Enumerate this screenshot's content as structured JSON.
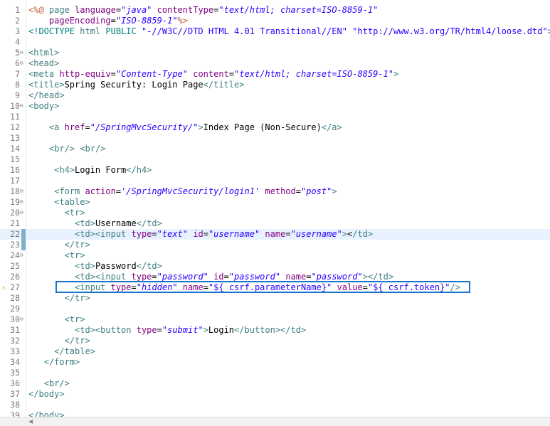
{
  "editor": {
    "current_line": 22,
    "lines": [
      {
        "n": "1",
        "fold": "",
        "tokens": [
          [
            "jsp",
            "<%@ "
          ],
          [
            "tag",
            "page "
          ],
          [
            "attr",
            "language"
          ],
          [
            "txt",
            "="
          ],
          [
            "val",
            "\"java\""
          ],
          [
            "txt",
            " "
          ],
          [
            "attr",
            "contentType"
          ],
          [
            "txt",
            "="
          ],
          [
            "val",
            "\"text/html; charset=ISO-8859-1\""
          ]
        ]
      },
      {
        "n": "2",
        "fold": "",
        "tokens": [
          [
            "txt",
            "    "
          ],
          [
            "attr",
            "pageEncoding"
          ],
          [
            "txt",
            "="
          ],
          [
            "val",
            "\"ISO-8859-1\""
          ],
          [
            "jsp",
            "%>"
          ]
        ]
      },
      {
        "n": "3",
        "fold": "",
        "tokens": [
          [
            "doc",
            "<!DOCTYPE "
          ],
          [
            "tag",
            "html "
          ],
          [
            "doc",
            "PUBLIC "
          ],
          [
            "valn",
            "\"-//W3C//DTD HTML 4.01 Transitional//EN\""
          ],
          [
            "txt",
            " "
          ],
          [
            "valn",
            "\"http://www.w3.org/TR/html4/loose.dtd\""
          ],
          [
            "doc",
            ">"
          ]
        ]
      },
      {
        "n": "4",
        "fold": "",
        "tokens": []
      },
      {
        "n": "5",
        "fold": "⊖",
        "tokens": [
          [
            "tag",
            "<html>"
          ]
        ]
      },
      {
        "n": "6",
        "fold": "⊖",
        "tokens": [
          [
            "tag",
            "<head>"
          ]
        ]
      },
      {
        "n": "7",
        "fold": "",
        "tokens": [
          [
            "tag",
            "<meta "
          ],
          [
            "attr",
            "http-equiv"
          ],
          [
            "txt",
            "="
          ],
          [
            "val",
            "\"Content-Type\""
          ],
          [
            "txt",
            " "
          ],
          [
            "attr",
            "content"
          ],
          [
            "txt",
            "="
          ],
          [
            "val",
            "\"text/html; charset=ISO-8859-1\""
          ],
          [
            "tag",
            ">"
          ]
        ]
      },
      {
        "n": "8",
        "fold": "",
        "tokens": [
          [
            "tag",
            "<title>"
          ],
          [
            "txt",
            "Spring Security: Login Page"
          ],
          [
            "tag",
            "</title>"
          ]
        ]
      },
      {
        "n": "9",
        "fold": "",
        "tokens": [
          [
            "tag",
            "</head>"
          ]
        ]
      },
      {
        "n": "10",
        "fold": "⊖",
        "tokens": [
          [
            "tag",
            "<body>"
          ]
        ]
      },
      {
        "n": "11",
        "fold": "",
        "tokens": []
      },
      {
        "n": "12",
        "fold": "",
        "tokens": [
          [
            "txt",
            "    "
          ],
          [
            "tag",
            "<a "
          ],
          [
            "attr",
            "href"
          ],
          [
            "txt",
            "="
          ],
          [
            "val",
            "\"/SpringMvcSecurity/\""
          ],
          [
            "tag",
            ">"
          ],
          [
            "txt",
            "Index Page (Non-Secure)"
          ],
          [
            "tag",
            "</a>"
          ]
        ]
      },
      {
        "n": "13",
        "fold": "",
        "tokens": []
      },
      {
        "n": "14",
        "fold": "",
        "tokens": [
          [
            "txt",
            "    "
          ],
          [
            "tag",
            "<br/>"
          ],
          [
            "txt",
            " "
          ],
          [
            "tag",
            "<br/>"
          ]
        ]
      },
      {
        "n": "15",
        "fold": "",
        "tokens": []
      },
      {
        "n": "16",
        "fold": "",
        "tokens": [
          [
            "txt",
            "     "
          ],
          [
            "tag",
            "<h4>"
          ],
          [
            "txt",
            "Login Form"
          ],
          [
            "tag",
            "</h4>"
          ]
        ]
      },
      {
        "n": "17",
        "fold": "",
        "tokens": []
      },
      {
        "n": "18",
        "fold": "⊖",
        "tokens": [
          [
            "txt",
            "     "
          ],
          [
            "tag",
            "<form "
          ],
          [
            "attr",
            "action"
          ],
          [
            "txt",
            "="
          ],
          [
            "val",
            "'/SpringMvcSecurity/login1'"
          ],
          [
            "txt",
            " "
          ],
          [
            "attr",
            "method"
          ],
          [
            "txt",
            "="
          ],
          [
            "val",
            "\"post\""
          ],
          [
            "tag",
            ">"
          ]
        ]
      },
      {
        "n": "19",
        "fold": "⊖",
        "tokens": [
          [
            "txt",
            "     "
          ],
          [
            "tag",
            "<table>"
          ]
        ]
      },
      {
        "n": "20",
        "fold": "⊖",
        "tokens": [
          [
            "txt",
            "       "
          ],
          [
            "tag",
            "<tr>"
          ]
        ]
      },
      {
        "n": "21",
        "fold": "",
        "tokens": [
          [
            "txt",
            "         "
          ],
          [
            "tag",
            "<td>"
          ],
          [
            "txt",
            "Username"
          ],
          [
            "tag",
            "</td>"
          ]
        ]
      },
      {
        "n": "22",
        "fold": "",
        "tokens": [
          [
            "txt",
            "         "
          ],
          [
            "tag",
            "<td><input "
          ],
          [
            "attr",
            "type"
          ],
          [
            "txt",
            "="
          ],
          [
            "val",
            "\"text\""
          ],
          [
            "txt",
            " "
          ],
          [
            "attr",
            "id"
          ],
          [
            "txt",
            "="
          ],
          [
            "val",
            "\"username\""
          ],
          [
            "txt",
            " "
          ],
          [
            "attr",
            "name"
          ],
          [
            "txt",
            "="
          ],
          [
            "val",
            "\"username\""
          ],
          [
            "tag",
            ">"
          ],
          [
            "txt",
            "<"
          ],
          [
            "tag",
            "/td>"
          ]
        ]
      },
      {
        "n": "23",
        "fold": "",
        "tokens": [
          [
            "txt",
            "       "
          ],
          [
            "tag",
            "</tr>"
          ]
        ]
      },
      {
        "n": "24",
        "fold": "⊖",
        "tokens": [
          [
            "txt",
            "       "
          ],
          [
            "tag",
            "<tr>"
          ]
        ]
      },
      {
        "n": "25",
        "fold": "",
        "tokens": [
          [
            "txt",
            "         "
          ],
          [
            "tag",
            "<td>"
          ],
          [
            "txt",
            "Password"
          ],
          [
            "tag",
            "</td>"
          ]
        ]
      },
      {
        "n": "26",
        "fold": "",
        "tokens": [
          [
            "txt",
            "         "
          ],
          [
            "tag",
            "<td><input "
          ],
          [
            "attr",
            "type"
          ],
          [
            "txt",
            "="
          ],
          [
            "val",
            "\"password\""
          ],
          [
            "txt",
            " "
          ],
          [
            "attr",
            "id"
          ],
          [
            "txt",
            "="
          ],
          [
            "val",
            "\"password\""
          ],
          [
            "txt",
            " "
          ],
          [
            "attr",
            "name"
          ],
          [
            "txt",
            "="
          ],
          [
            "val",
            "\"password\""
          ],
          [
            "tag",
            "></td>"
          ]
        ]
      },
      {
        "n": "27",
        "fold": "",
        "tokens": [
          [
            "txt",
            "         "
          ],
          [
            "tag",
            "<input "
          ],
          [
            "attr",
            "type"
          ],
          [
            "txt",
            "="
          ],
          [
            "val",
            "\"hidden\""
          ],
          [
            "txt",
            " "
          ],
          [
            "attr",
            "name"
          ],
          [
            "txt",
            "="
          ],
          [
            "valn",
            "\"${_csrf.parameterName}\""
          ],
          [
            "txt",
            " "
          ],
          [
            "attr",
            "value"
          ],
          [
            "txt",
            "="
          ],
          [
            "valn",
            "\"${_csrf.token}\""
          ],
          [
            "tag",
            "/>"
          ]
        ]
      },
      {
        "n": "28",
        "fold": "",
        "tokens": [
          [
            "txt",
            "       "
          ],
          [
            "tag",
            "</tr>"
          ]
        ]
      },
      {
        "n": "29",
        "fold": "",
        "tokens": []
      },
      {
        "n": "30",
        "fold": "⊖",
        "tokens": [
          [
            "txt",
            "       "
          ],
          [
            "tag",
            "<tr>"
          ]
        ]
      },
      {
        "n": "31",
        "fold": "",
        "tokens": [
          [
            "txt",
            "         "
          ],
          [
            "tag",
            "<td><button "
          ],
          [
            "attr",
            "type"
          ],
          [
            "txt",
            "="
          ],
          [
            "val",
            "\"submit\""
          ],
          [
            "tag",
            ">"
          ],
          [
            "txt",
            "Login"
          ],
          [
            "tag",
            "</button></td>"
          ]
        ]
      },
      {
        "n": "32",
        "fold": "",
        "tokens": [
          [
            "txt",
            "       "
          ],
          [
            "tag",
            "</tr>"
          ]
        ]
      },
      {
        "n": "33",
        "fold": "",
        "tokens": [
          [
            "txt",
            "     "
          ],
          [
            "tag",
            "</table>"
          ]
        ]
      },
      {
        "n": "34",
        "fold": "",
        "tokens": [
          [
            "txt",
            "   "
          ],
          [
            "tag",
            "</form>"
          ]
        ]
      },
      {
        "n": "35",
        "fold": "",
        "tokens": []
      },
      {
        "n": "36",
        "fold": "",
        "tokens": [
          [
            "txt",
            "   "
          ],
          [
            "tag",
            "<br/>"
          ]
        ]
      },
      {
        "n": "37",
        "fold": "",
        "tokens": [
          [
            "tag",
            "</body>"
          ]
        ]
      },
      {
        "n": "38",
        "fold": "",
        "tokens": []
      },
      {
        "n": "39",
        "fold": "",
        "tokens": [
          [
            "tag",
            "</body>"
          ]
        ]
      }
    ]
  },
  "annotations": {
    "warning_line": "27",
    "warning_icon": "warning-icon",
    "changed_lines": [
      "22",
      "23"
    ],
    "highlight_color": "#1a73c9"
  }
}
